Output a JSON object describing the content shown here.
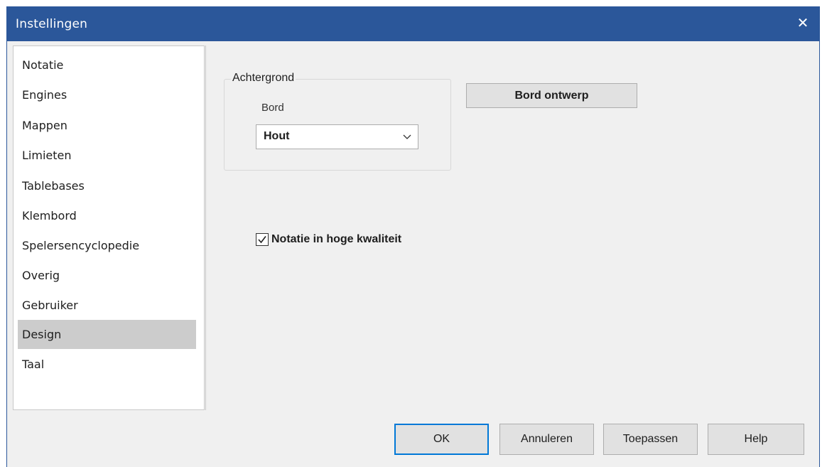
{
  "window": {
    "title": "Instellingen",
    "close_glyph": "✕"
  },
  "sidebar": {
    "items": [
      {
        "label": "Notatie"
      },
      {
        "label": "Engines"
      },
      {
        "label": "Mappen"
      },
      {
        "label": "Limieten"
      },
      {
        "label": "Tablebases"
      },
      {
        "label": "Klembord"
      },
      {
        "label": "Spelersencyclopedie"
      },
      {
        "label": "Overig"
      },
      {
        "label": "Gebruiker"
      },
      {
        "label": "Design",
        "selected": true
      },
      {
        "label": "Taal"
      }
    ]
  },
  "content": {
    "group_title": "Achtergrond",
    "board_label": "Bord",
    "board_select_value": "Hout",
    "design_button": "Bord ontwerp",
    "checkbox_label": "Notatie in hoge kwaliteit",
    "checkbox_checked": true
  },
  "footer": {
    "ok": "OK",
    "cancel": "Annuleren",
    "apply": "Toepassen",
    "help": "Help"
  },
  "colors": {
    "titlebar": "#2b579a",
    "selected_item": "#cccccc",
    "default_button_border": "#0078d7"
  }
}
